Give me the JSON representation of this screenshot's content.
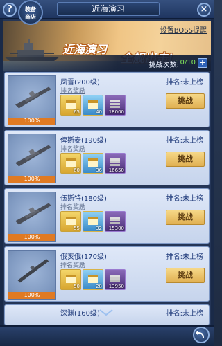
{
  "header": {
    "help_label": "?",
    "shop_label_1": "装备",
    "shop_label_2": "商店",
    "title": "近海演习",
    "close_label": "×"
  },
  "banner": {
    "slogan_1": "近海演习",
    "slogan_2": "全舰出击!",
    "boss_link": "设置BOSS提醒"
  },
  "attempts": {
    "label": "挑战次数:",
    "count": "10/10",
    "plus_label": "+"
  },
  "common": {
    "reward_label": "排名奖励",
    "fight_label": "挑战"
  },
  "ships": [
    {
      "name": "凤雪(200级)",
      "rank": "排名:未上榜",
      "hp": "100%",
      "rewards": [
        {
          "kind": "gold-chest",
          "qty": "65"
        },
        {
          "kind": "blue-chest",
          "qty": "40"
        },
        {
          "kind": "shells",
          "qty": "18000"
        }
      ]
    },
    {
      "name": "俾斯麦(190级)",
      "rank": "排名:未上榜",
      "hp": "100%",
      "rewards": [
        {
          "kind": "gold-chest",
          "qty": "60"
        },
        {
          "kind": "blue-chest",
          "qty": "36"
        },
        {
          "kind": "shells",
          "qty": "16650"
        }
      ]
    },
    {
      "name": "伍斯特(180级)",
      "rank": "排名:未上榜",
      "hp": "100%",
      "rewards": [
        {
          "kind": "gold-chest",
          "qty": "55"
        },
        {
          "kind": "blue-chest",
          "qty": "32"
        },
        {
          "kind": "shells",
          "qty": "15300"
        }
      ]
    },
    {
      "name": "俄亥俄(170级)",
      "rank": "排名:未上榜",
      "hp": "100%",
      "rewards": [
        {
          "kind": "gold-chest",
          "qty": "50"
        },
        {
          "kind": "blue-chest",
          "qty": "28"
        },
        {
          "kind": "shells",
          "qty": "13950"
        }
      ]
    },
    {
      "name": "深渊(160级)",
      "rank": "排名:未上榜"
    }
  ],
  "colors": {
    "accent": "#e07a22",
    "count": "#7ee05a",
    "button": "#e0b052"
  }
}
